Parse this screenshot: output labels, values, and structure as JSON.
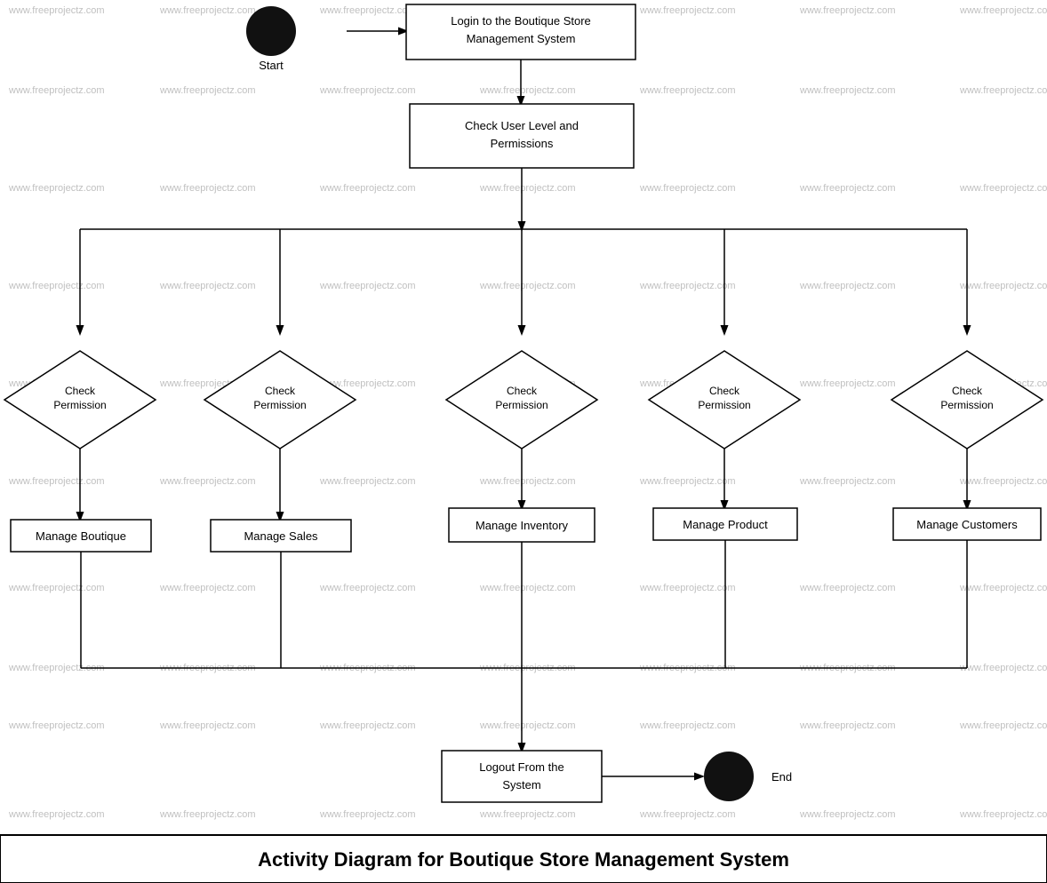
{
  "diagram": {
    "title": "Activity Diagram for Boutique Store Management System",
    "watermark": "www.freeprojectz.com",
    "nodes": {
      "start": {
        "label": "Start"
      },
      "login": {
        "label": "Login to the Boutique Store Management System"
      },
      "checkUserLevel": {
        "label": "Check User Level and Permissions"
      },
      "checkPermission1": {
        "label": "Check Permission"
      },
      "checkPermission2": {
        "label": "Check Permission"
      },
      "checkPermission3": {
        "label": "Check Permission"
      },
      "checkPermission4": {
        "label": "Check Permission"
      },
      "checkPermission5": {
        "label": "Check Permission"
      },
      "manageBoutique": {
        "label": "Manage Boutique"
      },
      "manageSales": {
        "label": "Manage Sales"
      },
      "manageInventory": {
        "label": "Manage Inventory"
      },
      "manageProduct": {
        "label": "Manage Product"
      },
      "manageCustomers": {
        "label": "Manage Customers"
      },
      "logout": {
        "label": "Logout From the System"
      },
      "end": {
        "label": "End"
      }
    }
  }
}
